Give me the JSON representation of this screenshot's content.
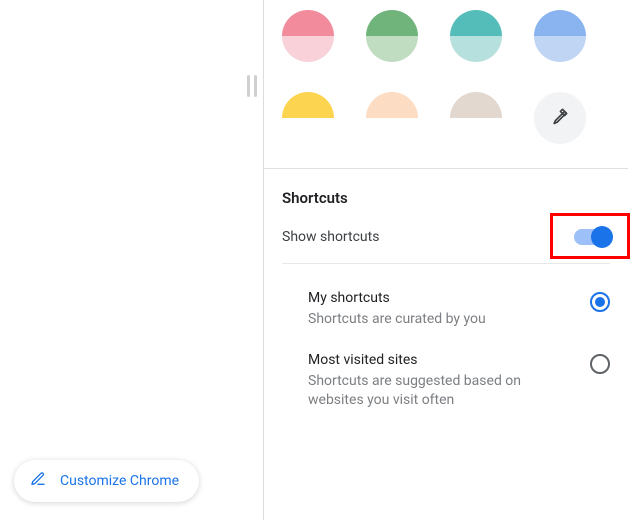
{
  "colors": [
    {
      "top": "#f28b9b",
      "bot": "#f9d1d8"
    },
    {
      "top": "#70b47c",
      "bot": "#c0ddc1"
    },
    {
      "top": "#55bdb9",
      "bot": "#b6e0dd"
    },
    {
      "top": "#8ab4f0",
      "bot": "#c0d5f3"
    },
    {
      "top": "#fcd450",
      "bot": "#ffffff"
    },
    {
      "top": "#fcdcc2",
      "bot": "#ffffff"
    },
    {
      "top": "#e2d8d0",
      "bot": "#ffffff"
    }
  ],
  "shortcuts": {
    "section_title": "Shortcuts",
    "show_label": "Show shortcuts",
    "show_enabled": true,
    "options": [
      {
        "title": "My shortcuts",
        "desc": "Shortcuts are curated by you",
        "selected": true
      },
      {
        "title": "Most visited sites",
        "desc": "Shortcuts are suggested based on websites you visit often",
        "selected": false
      }
    ]
  },
  "customize_label": "Customize Chrome"
}
